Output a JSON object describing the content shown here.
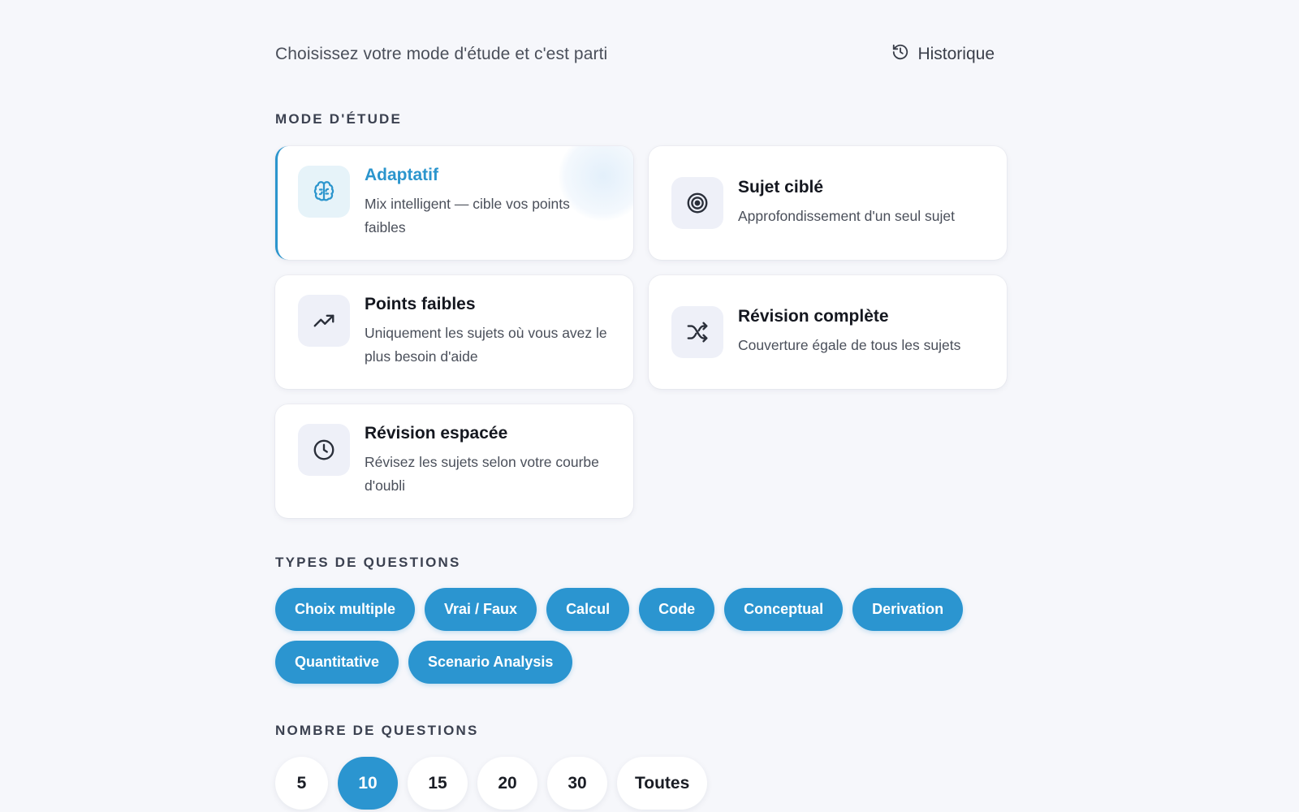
{
  "header": {
    "subtitle": "Choisissez votre mode d'étude et c'est parti",
    "history_label": "Historique",
    "history_icon": "history-icon"
  },
  "study_mode": {
    "section_label": "MODE D'ÉTUDE",
    "selected": "Adaptatif",
    "modes": [
      {
        "title": "Adaptatif",
        "description": "Mix intelligent — cible vos points faibles",
        "icon": "brain-icon"
      },
      {
        "title": "Sujet ciblé",
        "description": "Approfondissement d'un seul sujet",
        "icon": "target-icon"
      },
      {
        "title": "Points faibles",
        "description": "Uniquement les sujets où vous avez le plus besoin d'aide",
        "icon": "trending-up-icon"
      },
      {
        "title": "Révision complète",
        "description": "Couverture égale de tous les sujets",
        "icon": "shuffle-icon"
      },
      {
        "title": "Révision espacée",
        "description": "Révisez les sujets selon votre courbe d'oubli",
        "icon": "clock-icon"
      }
    ]
  },
  "question_types": {
    "section_label": "TYPES DE QUESTIONS",
    "items": [
      "Choix multiple",
      "Vrai / Faux",
      "Calcul",
      "Code",
      "Conceptual",
      "Derivation",
      "Quantitative",
      "Scenario Analysis"
    ]
  },
  "question_count": {
    "section_label": "NOMBRE DE QUESTIONS",
    "selected": "10",
    "options": [
      "5",
      "10",
      "15",
      "20",
      "30",
      "Toutes"
    ]
  },
  "colors": {
    "accent": "#2b95d0",
    "background": "#f6f7fb",
    "card": "#ffffff"
  }
}
